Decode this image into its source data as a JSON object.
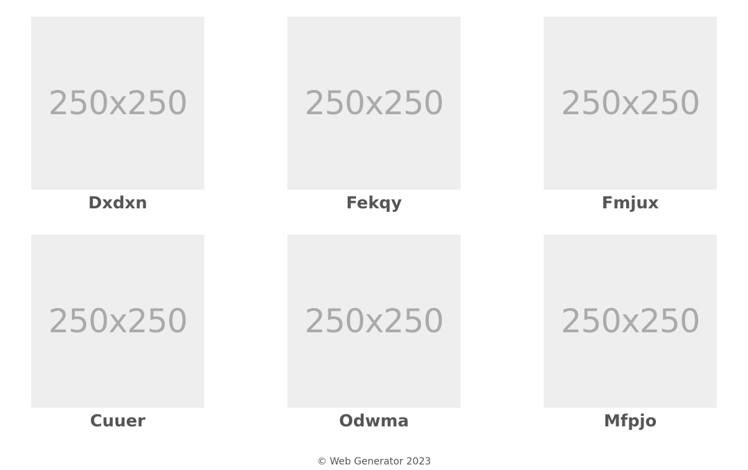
{
  "products": [
    {
      "image_text": "250x250",
      "title": "Dxdxn"
    },
    {
      "image_text": "250x250",
      "title": "Fekqy"
    },
    {
      "image_text": "250x250",
      "title": "Fmjux"
    },
    {
      "image_text": "250x250",
      "title": "Cuuer"
    },
    {
      "image_text": "250x250",
      "title": "Odwma"
    },
    {
      "image_text": "250x250",
      "title": "Mfpjo"
    }
  ],
  "footer": {
    "copyright": "© Web Generator 2023"
  },
  "colors": {
    "placeholder_bg": "#eeeeee",
    "placeholder_text": "#aaaaaa",
    "title_text": "#555555"
  }
}
